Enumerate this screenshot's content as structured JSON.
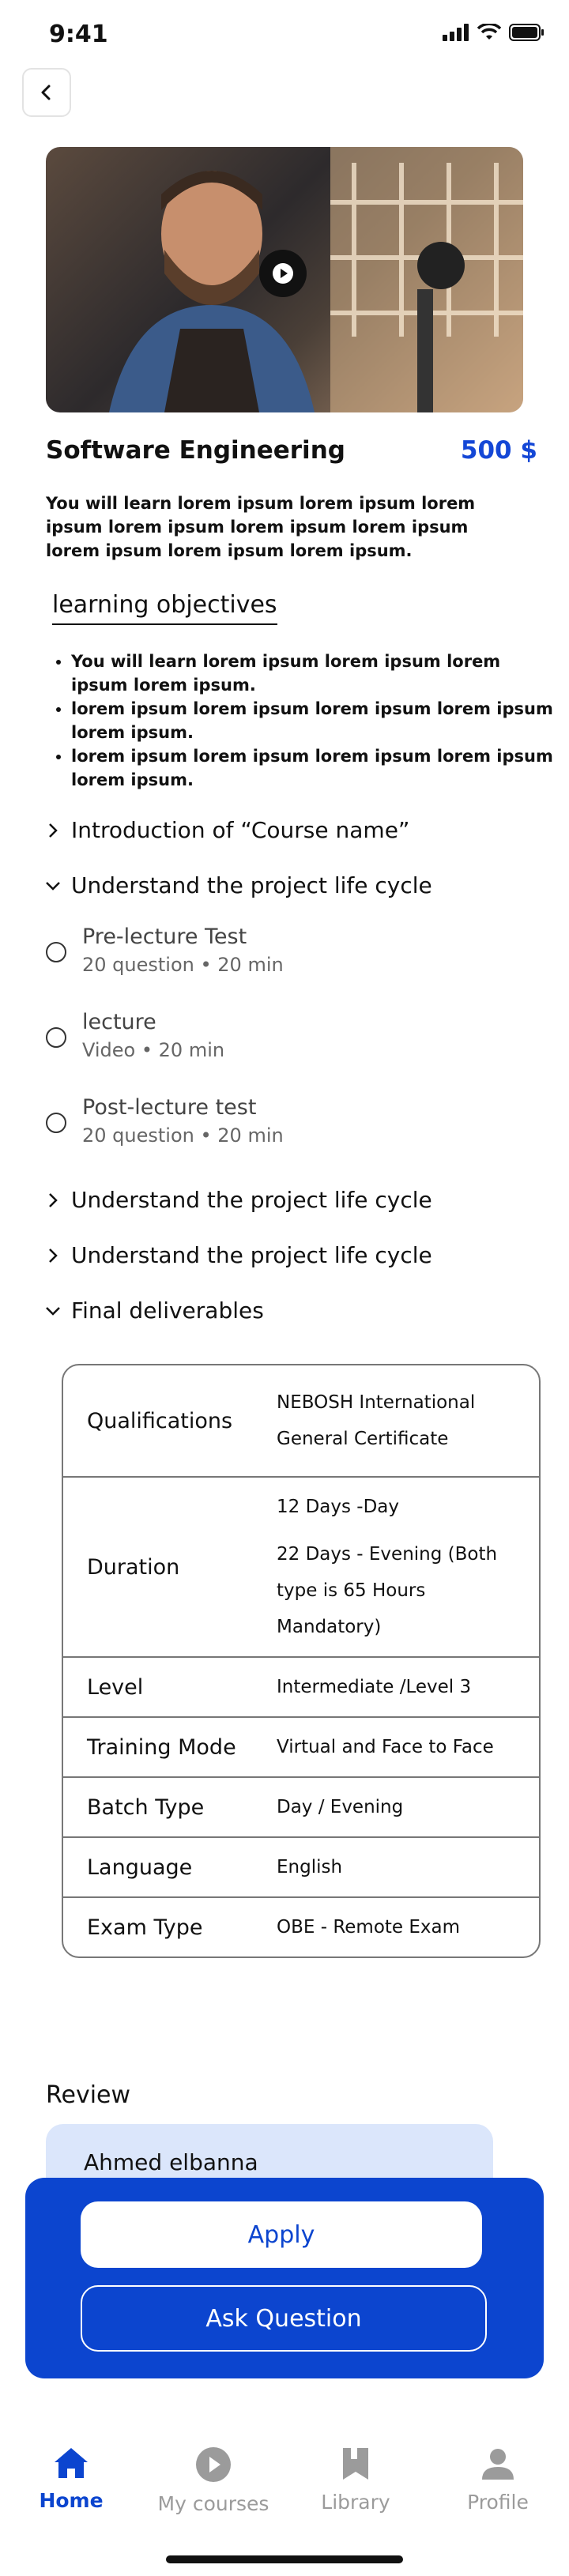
{
  "status": {
    "time": "9:41"
  },
  "course": {
    "title": "Software Engineering",
    "price": "500 $",
    "description": "You will learn lorem ipsum lorem ipsum lorem ipsum lorem ipsum lorem ipsum lorem ipsum lorem ipsum lorem ipsum lorem ipsum."
  },
  "objectives": {
    "heading": "learning objectives",
    "items": [
      "You will learn lorem ipsum lorem ipsum lorem ipsum lorem ipsum.",
      " lorem ipsum lorem ipsum lorem ipsum lorem ipsum lorem ipsum.",
      "lorem ipsum lorem ipsum lorem ipsum lorem ipsum lorem ipsum."
    ]
  },
  "sections": {
    "intro": "Introduction of “Course name”",
    "life_cycle_open": "Understand the project life cycle",
    "life_cycle_2": "Understand the project life cycle",
    "life_cycle_3": "Understand the project life cycle",
    "final": "Final deliverables"
  },
  "lessons": [
    {
      "title": "Pre-lecture Test",
      "sub": "20 question • 20 min"
    },
    {
      "title": "lecture",
      "sub": "Video • 20 min"
    },
    {
      "title": "Post-lecture test",
      "sub": "20 question • 20 min"
    }
  ],
  "info": [
    {
      "label": "Qualifications",
      "value": "NEBOSH International General Certificate"
    },
    {
      "label": "Duration",
      "value_1": "12 Days -Day",
      "value_2": "22 Days - Evening (Both type is 65 Hours Mandatory)"
    },
    {
      "label": "Level",
      "value": "Intermediate /Level 3"
    },
    {
      "label": "Training Mode",
      "value": "Virtual and Face to Face"
    },
    {
      "label": "Batch Type",
      "value": "Day / Evening"
    },
    {
      "label": "Language",
      "value": "English"
    },
    {
      "label": "Exam Type",
      "value": "OBE - Remote Exam"
    }
  ],
  "review": {
    "heading": "Review",
    "author": "Ahmed elbanna"
  },
  "actions": {
    "apply": "Apply",
    "ask": "Ask Question"
  },
  "nav": [
    {
      "label": "Home",
      "icon": "home-icon"
    },
    {
      "label": "My courses",
      "icon": "play-icon"
    },
    {
      "label": "Library",
      "icon": "bookmark-icon"
    },
    {
      "label": "Profile",
      "icon": "user-icon"
    }
  ],
  "colors": {
    "accent": "#0c45cf",
    "price": "#1447d6",
    "review_bg": "#dbe6fb"
  }
}
